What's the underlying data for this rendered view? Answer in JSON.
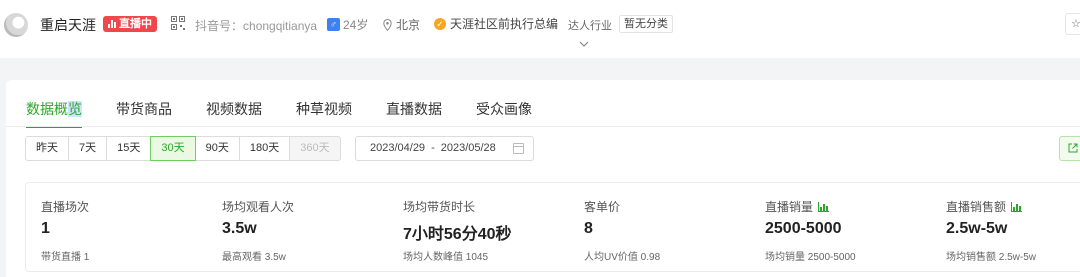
{
  "profile": {
    "name": "重启天涯",
    "live_badge": "直播中",
    "douyin_label": "抖音号：",
    "douyin_id": "chongqitianya",
    "age": "24岁",
    "location": "北京",
    "title": "天涯社区前执行总编",
    "industry": "达人行业",
    "category": "暂无分类"
  },
  "colors": {
    "accent": "#29a828",
    "live_red": "#f0474c",
    "age_blue": "#3b82f6",
    "verified_orange": "#f6a623"
  },
  "tabs": [
    {
      "label": "数据概览",
      "active": true
    },
    {
      "label": "带货商品",
      "active": false
    },
    {
      "label": "视频数据",
      "active": false
    },
    {
      "label": "种草视频",
      "active": false
    },
    {
      "label": "直播数据",
      "active": false
    },
    {
      "label": "受众画像",
      "active": false
    }
  ],
  "ranges": [
    {
      "label": "昨天",
      "state": "normal"
    },
    {
      "label": "7天",
      "state": "normal"
    },
    {
      "label": "15天",
      "state": "normal"
    },
    {
      "label": "30天",
      "state": "active"
    },
    {
      "label": "90天",
      "state": "normal"
    },
    {
      "label": "180天",
      "state": "normal"
    },
    {
      "label": "360天",
      "state": "disabled"
    }
  ],
  "date_range": {
    "start": "2023/04/29",
    "separator": "-",
    "end": "2023/05/28"
  },
  "metrics": [
    {
      "label": "直播场次",
      "value": "1",
      "sub": "带货直播 1",
      "chart_icon": false
    },
    {
      "label": "场均观看人次",
      "value": "3.5w",
      "sub": "最高观看 3.5w",
      "chart_icon": false
    },
    {
      "label": "场均带货时长",
      "value": "7小时56分40秒",
      "sub": "场均人数峰值 1045",
      "chart_icon": false
    },
    {
      "label": "客单价",
      "value": "8",
      "sub": "人均UV价值 0.98",
      "chart_icon": false
    },
    {
      "label": "直播销量",
      "value": "2500-5000",
      "sub": "场均销量 2500-5000",
      "chart_icon": true
    },
    {
      "label": "直播销售额",
      "value": "2.5w-5w",
      "sub": "场均销售额 2.5w-5w",
      "chart_icon": true
    }
  ],
  "icons": {
    "avatar": "avatar",
    "qr": "qr-code-icon",
    "location": "location-pin-icon",
    "verified": "verified-check-icon",
    "expand": "chevron-down-icon",
    "calendar": "calendar-icon",
    "export": "export-icon",
    "trend": "bar-chart-icon"
  }
}
